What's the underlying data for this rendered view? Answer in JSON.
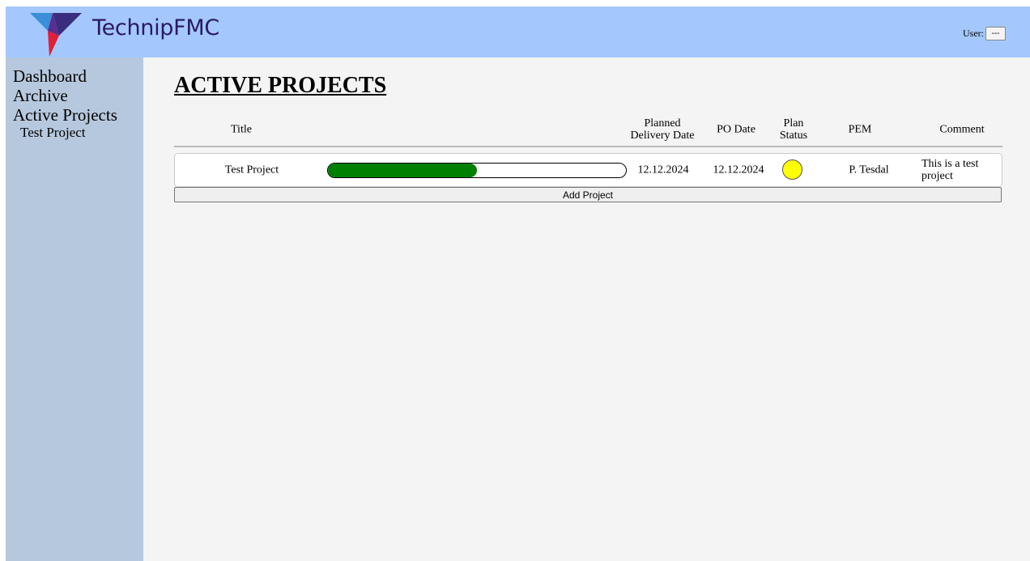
{
  "header": {
    "brand": "TechnipFMC",
    "user_label": "User:",
    "user_button": "---"
  },
  "sidebar": {
    "items": [
      {
        "label": "Dashboard"
      },
      {
        "label": "Archive"
      },
      {
        "label": "Active Projects"
      }
    ],
    "subitems": [
      {
        "label": "Test Project"
      }
    ]
  },
  "main": {
    "title": "ACTIVE PROJECTS",
    "columns": {
      "title": "Title",
      "planned_delivery": "Planned Delivery Date",
      "po_date": "PO Date",
      "plan_status": "Plan Status",
      "pem": "PEM",
      "comment": "Comment"
    },
    "rows": [
      {
        "title": "Test Project",
        "progress_percent": 50,
        "planned_delivery": "12.12.2024",
        "po_date": "12.12.2024",
        "status_color": "#ffff00",
        "pem": "P. Tesdal",
        "comment": "This is a test project"
      }
    ],
    "add_button": "Add Project"
  },
  "colors": {
    "header_bg": "#a4c8fd",
    "sidebar_bg": "#b6c8de",
    "progress_fill": "#008000",
    "brand_text": "#2a1a5e"
  }
}
